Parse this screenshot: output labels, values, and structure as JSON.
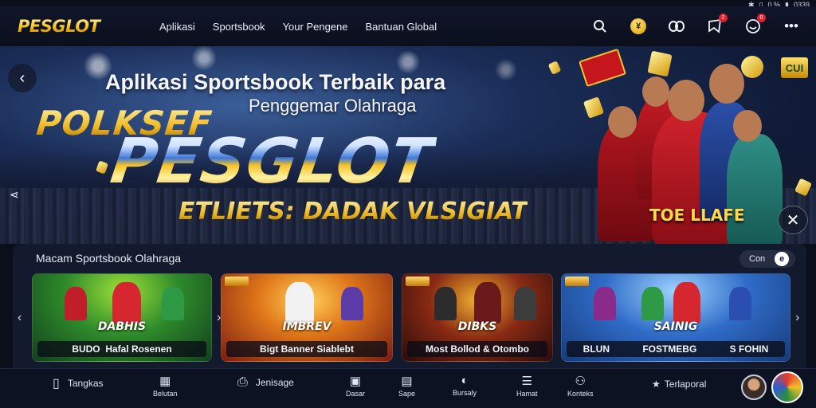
{
  "status": {
    "icons": [
      "bluetooth-icon",
      "vibrate-icon",
      "signal-icon",
      "battery-icon"
    ],
    "percent": "0 %",
    "time": "0339"
  },
  "header": {
    "logo": "PESGLOT",
    "menu": [
      "Aplikasi",
      "Sportsbook",
      "Your Pengene",
      "Bantuan Global"
    ],
    "icons": [
      "search-icon",
      "coin-icon",
      "link-icon",
      "notifications-icon",
      "messages-icon",
      "more-icon"
    ],
    "notification_count": "2",
    "message_count": "0"
  },
  "hero": {
    "title_line1": "Aplikasi Sportsbook Terbaik para",
    "title_line2": "Penggemar Olahraga",
    "poker_text": "POLKSEF",
    "brand": "PESGLOT",
    "tagline": "ETLIETS: DADAK VLSIGIAT",
    "side_text": "TOE LLAFE",
    "chip_text": "CUI"
  },
  "sports": {
    "title": "Macam Sportsbook Olahraga",
    "toggle_label": "Con",
    "toggle_icon": "e",
    "cards": [
      {
        "headline": "DABHIS",
        "label": "BUDO",
        "sub": "Hafal Rosenen"
      },
      {
        "headline": "IMBREV",
        "label": "Bigt Banner Siablebt",
        "sub": ""
      },
      {
        "headline": "DIBKS",
        "label": "Most Bollod & Otombo",
        "sub": ""
      },
      {
        "headline": "SAINIG",
        "label": "BLUN",
        "sub": "FOSTMEBG",
        "extra": "S FOHIN"
      }
    ]
  },
  "bottom_nav": {
    "items": [
      {
        "label": "Tangkas",
        "icon": "phone-icon"
      },
      {
        "label": "Belutan",
        "icon": "calendar-icon"
      },
      {
        "label": "Jenisage",
        "icon": "bookmark-icon"
      },
      {
        "label": "Dasar",
        "icon": "screen-icon"
      },
      {
        "label": "Sape",
        "icon": "picture-icon"
      },
      {
        "label": "Bursaly",
        "icon": "chat-icon"
      },
      {
        "label": "Hamat",
        "icon": "list-icon"
      },
      {
        "label": "Konteks",
        "icon": "contacts-icon"
      },
      {
        "label": "Terlaporal",
        "icon": "star-icon"
      }
    ]
  }
}
